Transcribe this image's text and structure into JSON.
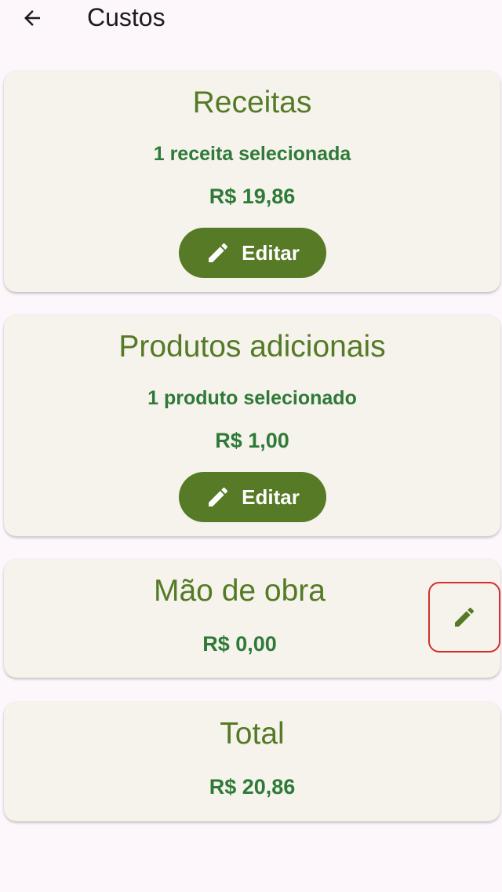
{
  "appbar": {
    "title": "Custos",
    "back_icon": "arrow-left-icon"
  },
  "cards": {
    "receitas": {
      "title": "Receitas",
      "subtitle": "1 receita selecionada",
      "amount": "R$ 19,86",
      "button_label": "Editar",
      "button_icon": "pencil-icon"
    },
    "produtos": {
      "title": "Produtos adicionais",
      "subtitle": "1 produto selecionado",
      "amount": "R$ 1,00",
      "button_label": "Editar",
      "button_icon": "pencil-icon"
    },
    "mao_de_obra": {
      "title": "Mão de obra",
      "amount": "R$ 0,00",
      "button_icon": "pencil-icon"
    },
    "total": {
      "title": "Total",
      "amount": "R$ 20,86"
    }
  },
  "colors": {
    "background": "#fdf7fc",
    "card": "#f5f3ec",
    "title_green": "#557a26",
    "amount_green": "#2f7a38",
    "button_green": "#567a26",
    "highlight_red": "#d32f2f"
  }
}
